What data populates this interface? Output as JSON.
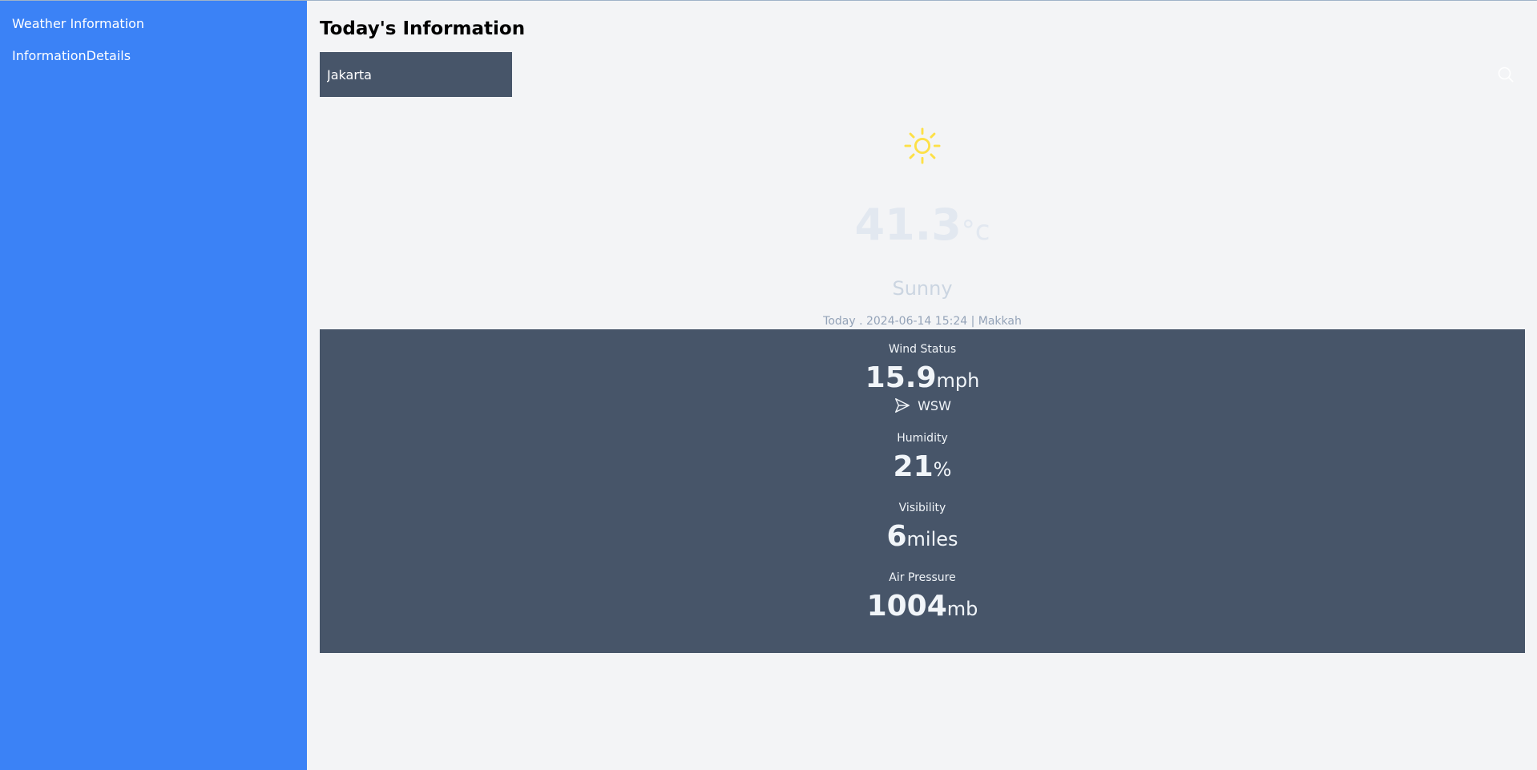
{
  "sidebar": {
    "items": [
      {
        "label": "Weather Information"
      },
      {
        "label": "InformationDetails"
      }
    ]
  },
  "main": {
    "title": "Today's Information",
    "search": {
      "value": "Jakarta",
      "icon": "search-icon"
    }
  },
  "current": {
    "icon": "sun-icon",
    "temperature": "41.3",
    "unit": "°c",
    "condition": "Sunny",
    "date_line": "Today . 2024-06-14 15:24 | Makkah"
  },
  "details": {
    "wind": {
      "label": "Wind Status",
      "value": "15.9",
      "unit": "mph",
      "direction": "WSW",
      "direction_icon": "send-arrow-icon"
    },
    "humidity": {
      "label": "Humidity",
      "value": "21",
      "unit": "%"
    },
    "visibility": {
      "label": "Visibility",
      "value": "6",
      "unit": "miles"
    },
    "pressure": {
      "label": "Air Pressure",
      "value": "1004",
      "unit": "mb"
    }
  },
  "colors": {
    "sidebar": "#3b82f6",
    "panel": "#475569",
    "background": "#f3f4f6",
    "sun": "#fde047"
  }
}
